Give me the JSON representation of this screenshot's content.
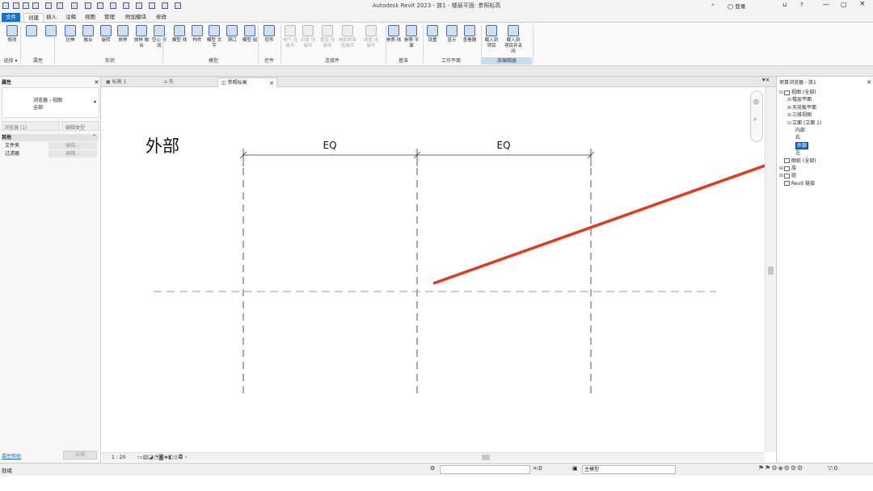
{
  "app": {
    "title": "Autodesk Revit 2023 - 族1 - 楼层平面: 参照标高",
    "user": "登录"
  },
  "menu_tabs": [
    {
      "label": "文件",
      "kind": "file"
    },
    {
      "label": "创建",
      "kind": "active"
    },
    {
      "label": "插入"
    },
    {
      "label": "注释"
    },
    {
      "label": "视图"
    },
    {
      "label": "管理"
    },
    {
      "label": "附加模块"
    },
    {
      "label": "修改"
    }
  ],
  "ribbon": {
    "buttons": [
      {
        "label": "修改"
      },
      {
        "label": ""
      },
      {
        "label": ""
      },
      {
        "label": "拉伸"
      },
      {
        "label": "融合"
      },
      {
        "label": "旋转"
      },
      {
        "label": "放样"
      },
      {
        "label": "放样 融合"
      },
      {
        "label": "空心 形状"
      },
      {
        "label": "模型 线"
      },
      {
        "label": "构件"
      },
      {
        "label": "模型 文字"
      },
      {
        "label": "洞口"
      },
      {
        "label": "模型 组"
      },
      {
        "label": "控件"
      },
      {
        "label": "电气 连接件",
        "dim": true
      },
      {
        "label": "风管 连接件",
        "dim": true
      },
      {
        "label": "管道 连接件",
        "dim": true
      },
      {
        "label": "电缆桥架 连接件",
        "dim": true
      },
      {
        "label": "线管 连接件",
        "dim": true
      },
      {
        "label": "参照 线"
      },
      {
        "label": "参照 平面"
      },
      {
        "label": "设置"
      },
      {
        "label": "显示"
      },
      {
        "label": "查看器"
      },
      {
        "label": "载入到 项目"
      },
      {
        "label": "载入到 项目并关闭"
      }
    ],
    "panels": [
      {
        "label": "选择 ▾"
      },
      {
        "label": "属性"
      },
      {
        "label": "形状"
      },
      {
        "label": "模型"
      },
      {
        "label": "控件"
      },
      {
        "label": "连接件"
      },
      {
        "label": "基准"
      },
      {
        "label": "工作平面"
      },
      {
        "label": "族编辑器",
        "highlight": true
      }
    ]
  },
  "properties": {
    "title": "属性",
    "type_name": "浏览器 - 视图",
    "type_value": "全部",
    "selector": "浏览器 (1)",
    "edit_type": "编辑类型",
    "category": "其他",
    "rows": [
      {
        "name": "文件夹",
        "value": "编辑..."
      },
      {
        "name": "过滤器",
        "value": "编辑..."
      }
    ],
    "help_link": "属性帮助",
    "apply": "应用"
  },
  "view_tabs": [
    {
      "label": "标高 1"
    },
    {
      "label": "东"
    },
    {
      "label": "参照标高",
      "active": true
    }
  ],
  "canvas": {
    "view_label": "外部",
    "dims": [
      "EQ",
      "EQ"
    ]
  },
  "browser": {
    "title": "项目浏览器 - 族1",
    "nodes": [
      {
        "label": "视图 (全部)",
        "toggle": "⊟",
        "icon": true
      },
      {
        "label": "楼层平面",
        "toggle": "⊞"
      },
      {
        "label": "天花板平面",
        "toggle": "⊞"
      },
      {
        "label": "三维视图",
        "toggle": "⊞"
      },
      {
        "label": "立面 (立面 1)",
        "toggle": "⊟"
      },
      {
        "label": "内部"
      },
      {
        "label": "右"
      },
      {
        "label": "外部",
        "selected": true
      },
      {
        "label": "左"
      },
      {
        "label": "图纸 (全部)",
        "toggle": "",
        "icon": true
      },
      {
        "label": "族",
        "toggle": "⊞",
        "icon": true
      },
      {
        "label": "组",
        "toggle": "⊞",
        "icon": true
      },
      {
        "label": "Revit 链接",
        "toggle": "",
        "icon": true
      }
    ]
  },
  "view_controls": {
    "scale": "1 : 20"
  },
  "status": {
    "text": "就绪",
    "workset": "主模型",
    "count": ":0",
    "filter": ":0"
  }
}
